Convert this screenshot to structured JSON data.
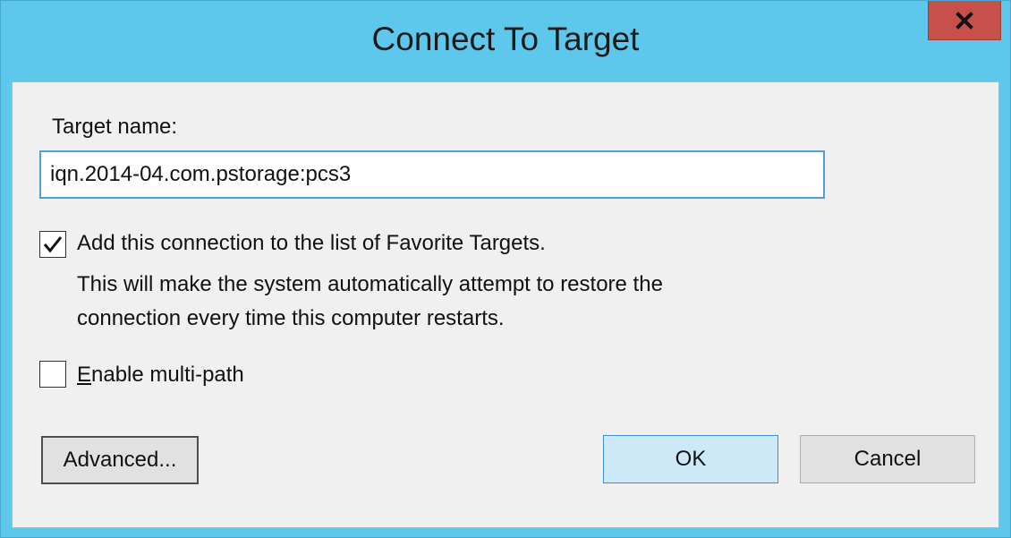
{
  "window": {
    "title": "Connect To Target",
    "close_label": "x"
  },
  "form": {
    "target_label": "Target name:",
    "target_value": "iqn.2014-04.com.pstorage:pcs3",
    "favorite": {
      "checked": true,
      "label": "Add this connection to the list of Favorite Targets.",
      "description_line1": "This will make the system automatically attempt to restore the",
      "description_line2": "connection every time this computer restarts."
    },
    "multipath": {
      "checked": false,
      "label": "Enable multi-path"
    }
  },
  "buttons": {
    "advanced": "Advanced...",
    "ok": "OK",
    "cancel": "Cancel"
  },
  "colors": {
    "titlebar": "#5ec8ec",
    "close": "#c7504a",
    "ok_highlight": "#cde8f7"
  }
}
